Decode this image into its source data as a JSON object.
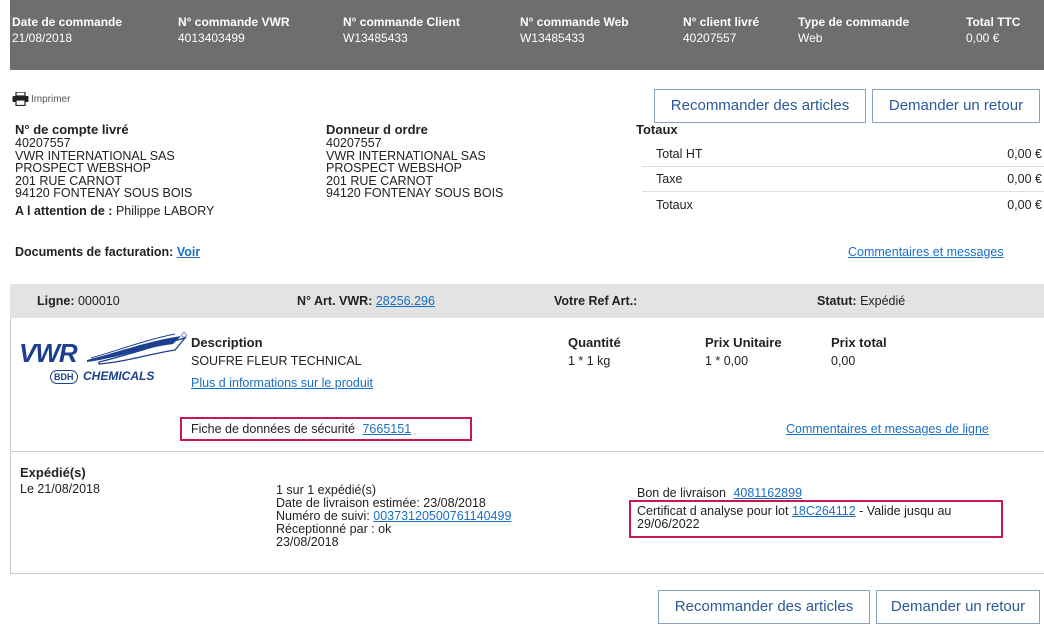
{
  "header": {
    "columns": [
      {
        "label": "Date de commande",
        "value": "21/08/2018"
      },
      {
        "label": "N° commande VWR",
        "value": "4013403499"
      },
      {
        "label": "N° commande Client",
        "value": "W13485433"
      },
      {
        "label": "N° commande Web",
        "value": "W13485433"
      },
      {
        "label": "N° client livré",
        "value": "40207557"
      },
      {
        "label": "Type de commande",
        "value": "Web"
      },
      {
        "label": "Total TTC",
        "value": "0,00 €"
      }
    ]
  },
  "actions": {
    "print_label": "Imprimer",
    "reorder_label": "Recommander des articles",
    "return_label": "Demander un retour"
  },
  "account": {
    "title": "N° de compte livré",
    "lines": [
      "40207557",
      "VWR INTERNATIONAL SAS",
      "PROSPECT WEBSHOP",
      "201 RUE CARNOT",
      "94120 FONTENAY SOUS BOIS"
    ],
    "attention_label": "A l attention de :",
    "attention_value": "Philippe LABORY"
  },
  "orderer": {
    "title": "Donneur d ordre",
    "lines": [
      "40207557",
      "VWR INTERNATIONAL SAS",
      "PROSPECT WEBSHOP",
      "201 RUE CARNOT",
      "94120 FONTENAY SOUS BOIS"
    ]
  },
  "totals": {
    "title": "Totaux",
    "rows": [
      {
        "label": "Total HT",
        "value": "0,00 €"
      },
      {
        "label": "Taxe",
        "value": "0,00 €"
      },
      {
        "label": "Totaux",
        "value": "0,00 €"
      }
    ]
  },
  "billing": {
    "label": "Documents de facturation:",
    "link": "Voir"
  },
  "comments_link": "Commentaires et messages",
  "line": {
    "line_label": "Ligne:",
    "line_value": "000010",
    "art_label": "N° Art. VWR:",
    "art_value": "28256.296",
    "ref_label": "Votre Ref Art.:",
    "status_label": "Statut:",
    "status_value": "Expédié"
  },
  "item": {
    "logo_text": "VWR",
    "logo_badge": "BDH",
    "logo_sub": "CHEMICALS",
    "description_label": "Description",
    "description_value": "SOUFRE FLEUR TECHNICAL",
    "more_info_link": "Plus d informations sur le produit",
    "quantity_label": "Quantité",
    "quantity_value": "1 * 1 kg",
    "unit_price_label": "Prix Unitaire",
    "unit_price_value": "1 * 0,00",
    "total_price_label": "Prix total",
    "total_price_value": "0,00",
    "sds_label": "Fiche de données de sécurité",
    "sds_link": "7665151",
    "line_comments_link": "Commentaires et messages de ligne"
  },
  "shipment": {
    "title": "Expédié(s)",
    "date": "Le 21/08/2018",
    "count": "1 sur 1 expédié(s)",
    "est_delivery": "Date de livraison estimée: 23/08/2018",
    "tracking_label": "Numéro de suivi:",
    "tracking_link": "00373120500761140499",
    "received_label": "Réceptionné par : ok",
    "received_date": "23/08/2018",
    "delivery_note_label": "Bon de livraison",
    "delivery_note_link": "4081162899",
    "coa_label": "Certificat d analyse pour lot",
    "coa_link": "18C264112",
    "coa_valid": "- Valide jusqu au",
    "coa_date": "29/06/2022"
  }
}
